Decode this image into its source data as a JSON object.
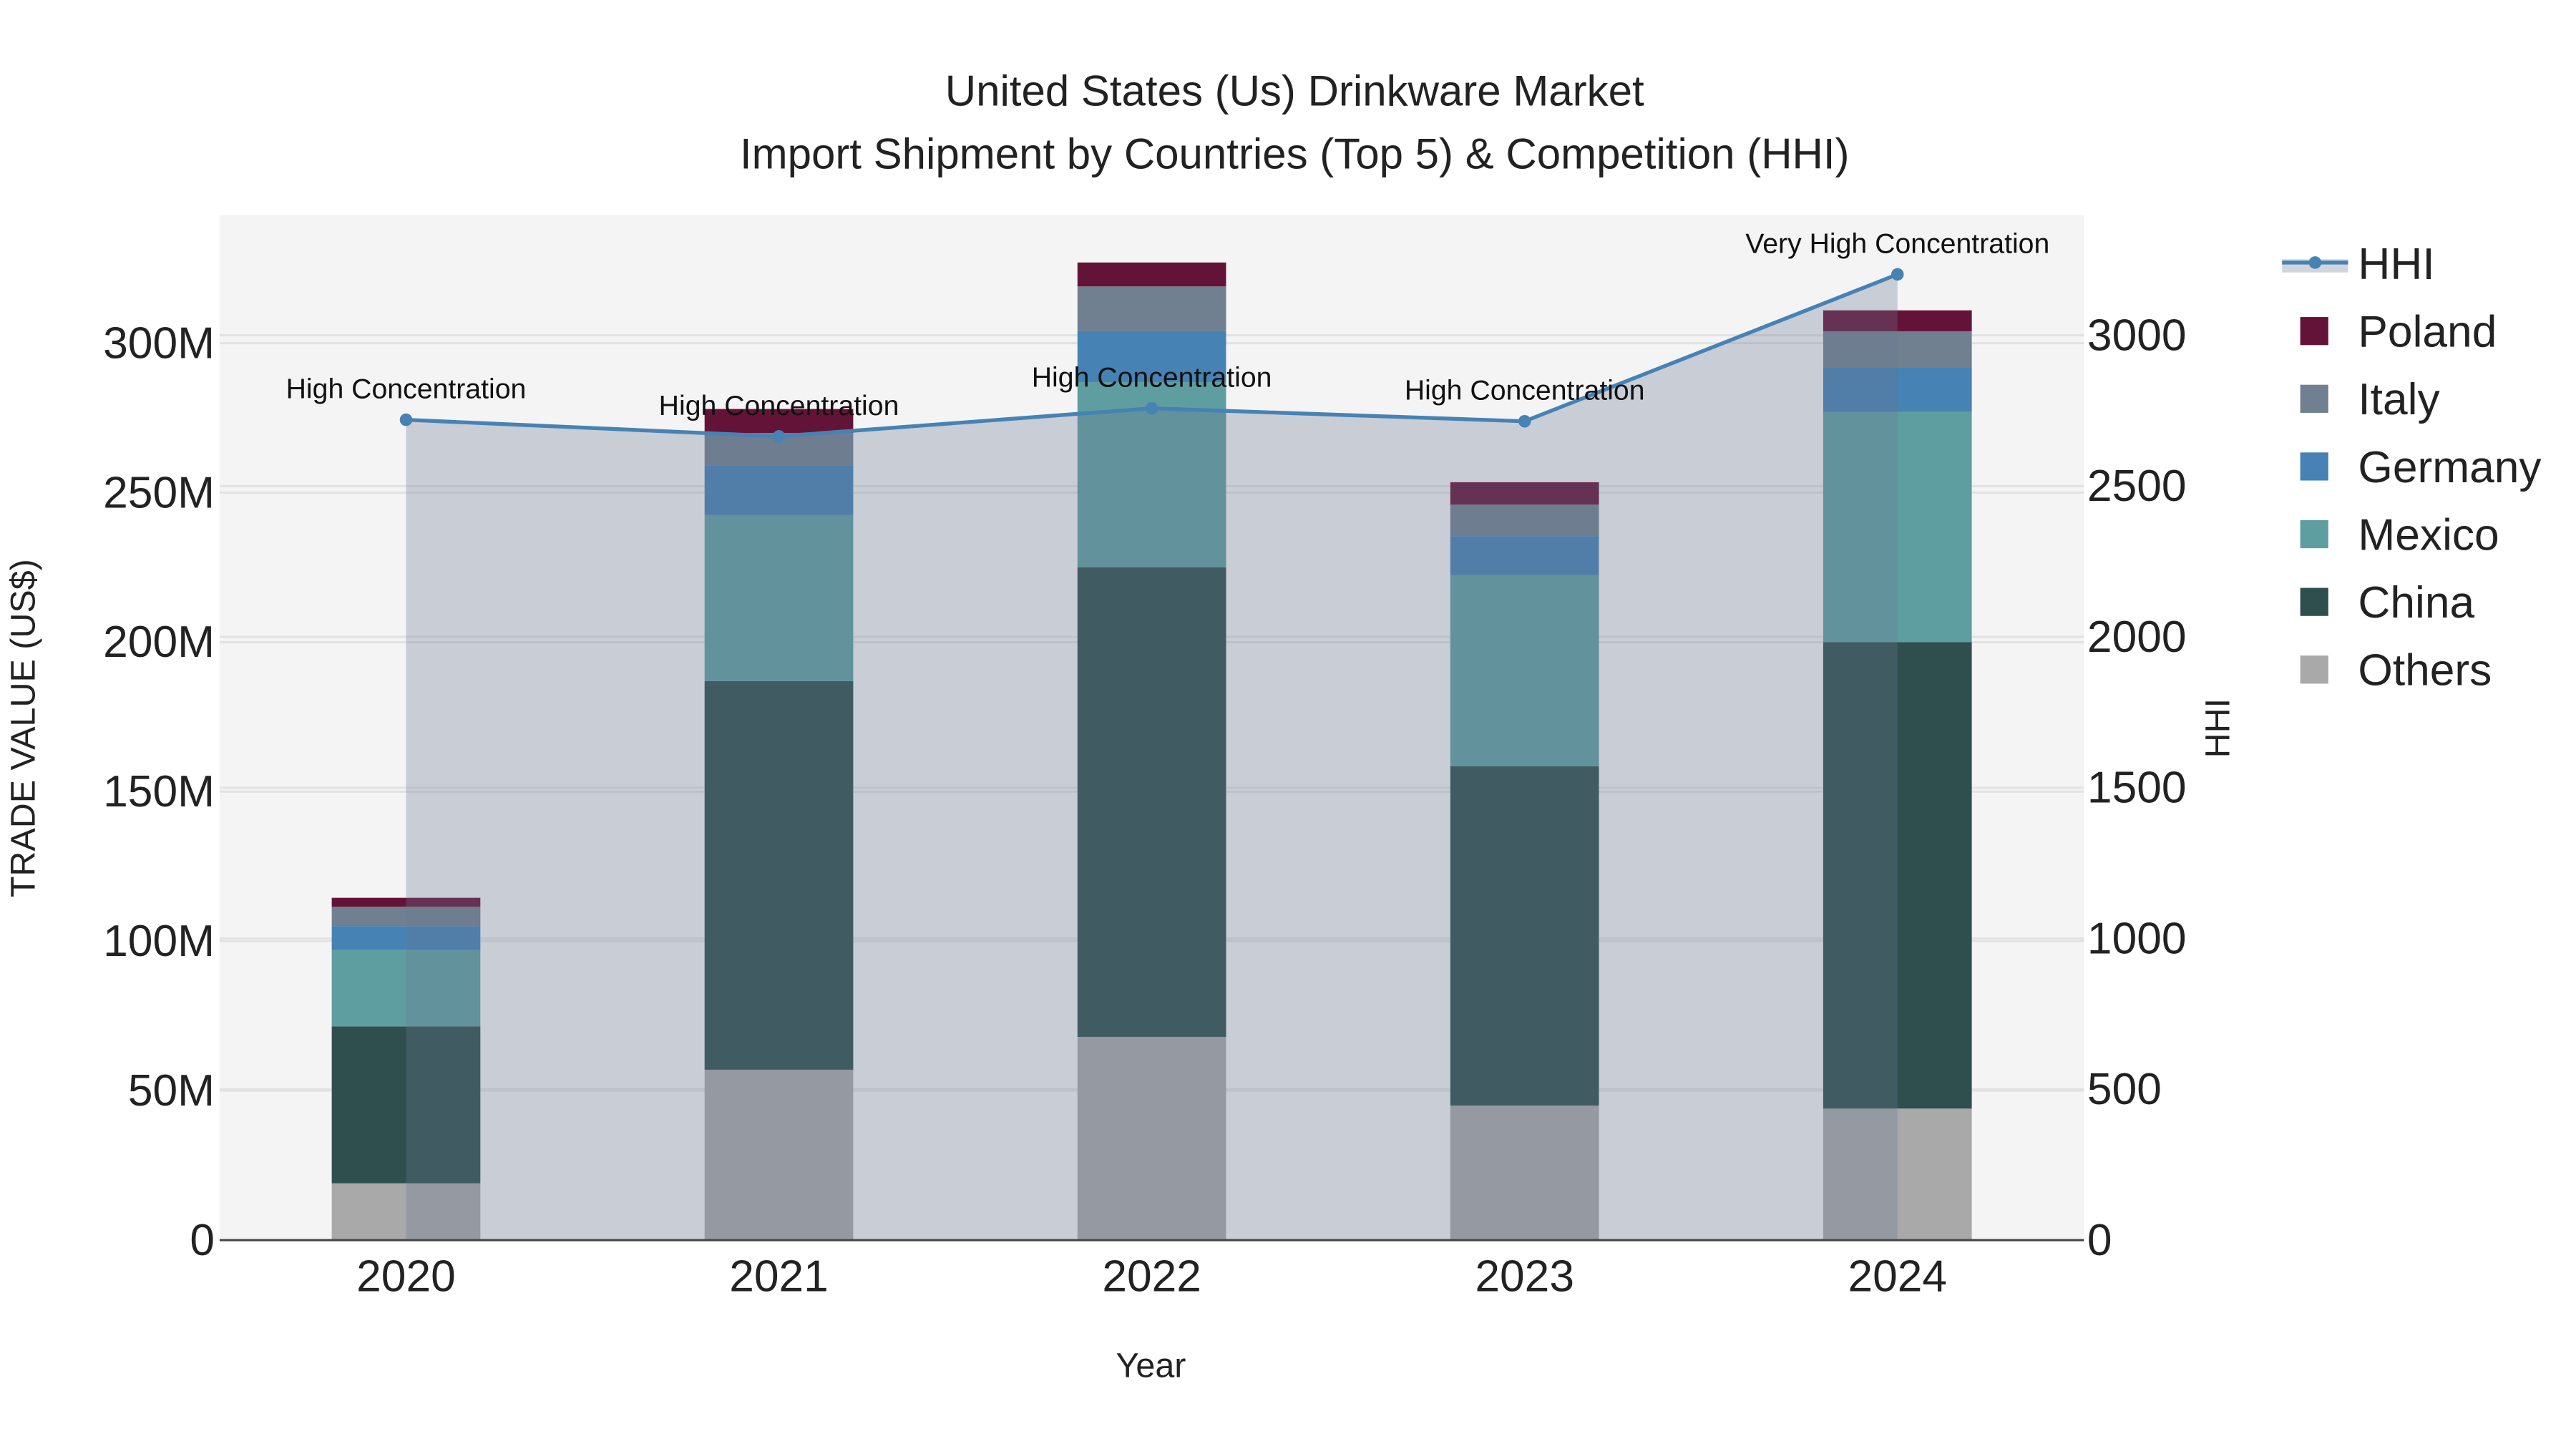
{
  "chart_data": {
    "type": "bar",
    "title": "United States (Us) Drinkware Market",
    "subtitle": "Import Shipment by Countries (Top 5) & Competition (HHI)",
    "xlabel": "Year",
    "ylabel": "TRADE VALUE (US$)",
    "y2label": "HHI",
    "categories": [
      "2020",
      "2021",
      "2022",
      "2023",
      "2024"
    ],
    "stacked": true,
    "ylim": [
      0,
      343
    ],
    "y_unit": "M",
    "y_ticks": [
      0,
      50,
      100,
      150,
      200,
      250,
      300
    ],
    "y_tick_labels": [
      "0",
      "50M",
      "100M",
      "150M",
      "200M",
      "250M",
      "300M"
    ],
    "y2lim": [
      0,
      3400
    ],
    "y2_ticks": [
      0,
      500,
      1000,
      1500,
      2000,
      2500,
      3000
    ],
    "y2_tick_labels": [
      "0",
      "500",
      "1000",
      "1500",
      "2000",
      "2500",
      "3000"
    ],
    "grid": true,
    "legend_placement": "right",
    "series": [
      {
        "name": "Others",
        "color": "#a9a9a9",
        "values": [
          19,
          57,
          68,
          45,
          44
        ]
      },
      {
        "name": "China",
        "color": "#2f4f4f",
        "values": [
          52.5,
          130,
          157,
          113.5,
          156
        ]
      },
      {
        "name": "Mexico",
        "color": "#5f9ea0",
        "values": [
          25.5,
          55.5,
          62,
          64,
          77
        ]
      },
      {
        "name": "Germany",
        "color": "#4682b4",
        "values": [
          8,
          16.5,
          17,
          13,
          15
        ]
      },
      {
        "name": "Italy",
        "color": "#708090",
        "values": [
          6.5,
          11,
          15,
          10.5,
          12
        ]
      },
      {
        "name": "Poland",
        "color": "#641338",
        "values": [
          3,
          8,
          8,
          7.5,
          7
        ]
      }
    ],
    "line": {
      "name": "HHI",
      "color": "#4682b4",
      "values": [
        2720,
        2665,
        2758,
        2715,
        3202
      ],
      "annotations": [
        "High Concentration",
        "High Concentration",
        "High Concentration",
        "High Concentration",
        "Very High Concentration"
      ]
    },
    "legend_order": [
      "HHI",
      "Poland",
      "Italy",
      "Germany",
      "Mexico",
      "China",
      "Others"
    ]
  }
}
